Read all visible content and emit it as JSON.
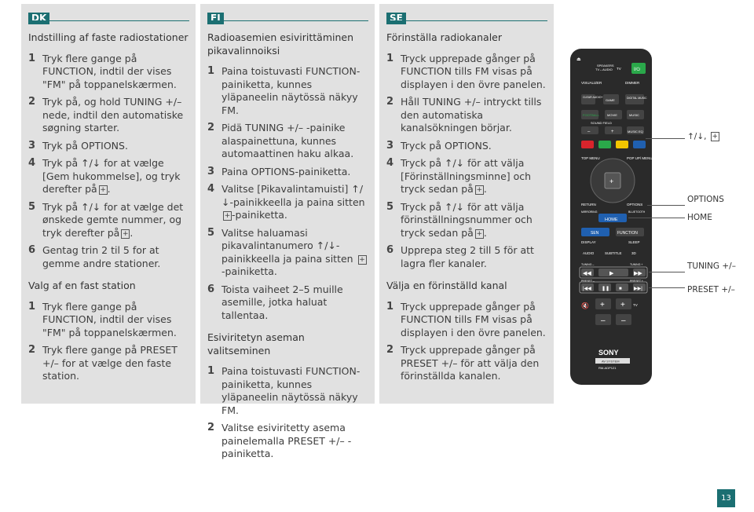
{
  "dk": {
    "lang": "DK",
    "title": "Indstilling af faste radiostationer",
    "steps": [
      {
        "num": "1",
        "text": "Tryk flere gange på FUNCTION, indtil der vises \"FM\" på toppanelskærmen."
      },
      {
        "num": "2",
        "text": "Tryk på, og hold TUNING +/– nede, indtil den automatiske søgning starter."
      },
      {
        "num": "3",
        "text": "Tryk på OPTIONS."
      },
      {
        "num": "4",
        "text": "Tryk på ↑/↓ for at vælge [Gem hukommelse], og tryk derefter på"
      },
      {
        "num": "5",
        "text": "Tryk på ↑/↓ for at vælge det ønskede gemte nummer, og tryk derefter på"
      },
      {
        "num": "6",
        "text": "Gentag trin 2 til 5 for at gemme andre stationer."
      }
    ],
    "title2": "Valg af en fast station",
    "steps2": [
      {
        "num": "1",
        "text": "Tryk flere gange på FUNCTION, indtil der vises \"FM\" på toppanelskærmen."
      },
      {
        "num": "2",
        "text": "Tryk flere gange på PRESET +/– for at vælge den faste station."
      }
    ]
  },
  "fi": {
    "lang": "FI",
    "title": "Radioasemien esivirittäminen pikavalinnoiksi",
    "steps": [
      {
        "num": "1",
        "text": "Paina toistuvasti FUNCTION-painiketta, kunnes yläpaneelin näytössä näkyy FM."
      },
      {
        "num": "2",
        "text": "Pidä TUNING +/– -painike alaspainettuna, kunnes automaattinen haku alkaa."
      },
      {
        "num": "3",
        "text": "Paina OPTIONS-painiketta."
      },
      {
        "num": "4",
        "text": "Valitse [Pikavalintamuisti] ↑/↓-painikkeella ja paina sitten"
      },
      {
        "num": "5",
        "text": "Valitse haluamasi pikavalintanumero ↑/↓-painikkeella ja paina sitten"
      },
      {
        "num": "6",
        "text": "Toista vaiheet 2–5 muille asemille, jotka haluat tallentaa."
      }
    ],
    "step4_tail": "-painiketta.",
    "step5_tail": "-painiketta.",
    "title2": "Esiviritetyn aseman valitseminen",
    "steps2": [
      {
        "num": "1",
        "text": "Paina toistuvasti FUNCTION-painiketta, kunnes yläpaneelin näytössä näkyy FM."
      },
      {
        "num": "2",
        "text": "Valitse esiviritetty asema painelemalla PRESET +/– -painiketta."
      }
    ]
  },
  "se": {
    "lang": "SE",
    "title": "Förinställa radiokanaler",
    "steps": [
      {
        "num": "1",
        "text": "Tryck upprepade gånger på FUNCTION tills FM visas på displayen i den övre panelen."
      },
      {
        "num": "2",
        "text": "Håll TUNING +/– intryckt tills den automatiska kanalsökningen börjar."
      },
      {
        "num": "3",
        "text": "Tryck på OPTIONS."
      },
      {
        "num": "4",
        "text": "Tryck på ↑/↓ för att välja [Förinställningsminne] och tryck sedan på"
      },
      {
        "num": "5",
        "text": "Tryck på ↑/↓ för att välja förinställningsnummer och tryck sedan på"
      },
      {
        "num": "6",
        "text": "Upprepa steg 2 till 5 för att lagra fler kanaler."
      }
    ],
    "title2": "Välja en förinställd kanal",
    "steps2": [
      {
        "num": "1",
        "text": "Tryck upprepade gånger på FUNCTION tills FM visas på displayen i den övre panelen."
      },
      {
        "num": "2",
        "text": "Tryck upprepade gånger på PRESET +/– för att välja den förinställda kanalen."
      }
    ]
  },
  "remote": {
    "callouts": {
      "arrows": "↑/↓,",
      "options": "OPTIONS",
      "home": "HOME",
      "tuning": "TUNING +/–",
      "preset": "PRESET +/–"
    },
    "labels": {
      "speakers": "SPEAKERS",
      "tv_audio": "TV↔AUDIO",
      "tv": "TV",
      "visualizer": "VISUALIZER",
      "dimmer": "DIMMER",
      "clear_audio": "CLEAR AUDIO+",
      "game": "GAME",
      "digital_music": "DIGITAL MUSIC",
      "football": "FOOTBALL",
      "movie": "MOVIE",
      "music": "MUSIC",
      "sound_field": "SOUND FIELD",
      "music_eq": "MUSIC EQ",
      "top_menu": "TOP MENU",
      "popup_menu": "POP UP/ MENU",
      "return": "RETURN",
      "options": "OPTIONS",
      "mirroring": "MIRRORING",
      "bluetooth": "BLUETOOTH",
      "home": "HOME",
      "sen": "SEN",
      "function": "FUNCTION",
      "display": "DISPLAY",
      "sleep": "SLEEP",
      "audio": "AUDIO",
      "subtitle": "SUBTITLE",
      "3d": "3D",
      "tuning_minus": "TUNING –",
      "tuning_plus": "TUNING +",
      "preset_minus": "PRESET –",
      "preset_plus": "PRESET +",
      "tv_input": "TV",
      "brand": "SONY",
      "system": "AV SYSTEM",
      "model": "RM-ADP121"
    },
    "colors": {
      "red": "#d8242c",
      "green": "#2aa84a",
      "yellow": "#f2c500",
      "blue": "#2060b0",
      "accent": "#1b6f72"
    }
  },
  "page_number": "13"
}
